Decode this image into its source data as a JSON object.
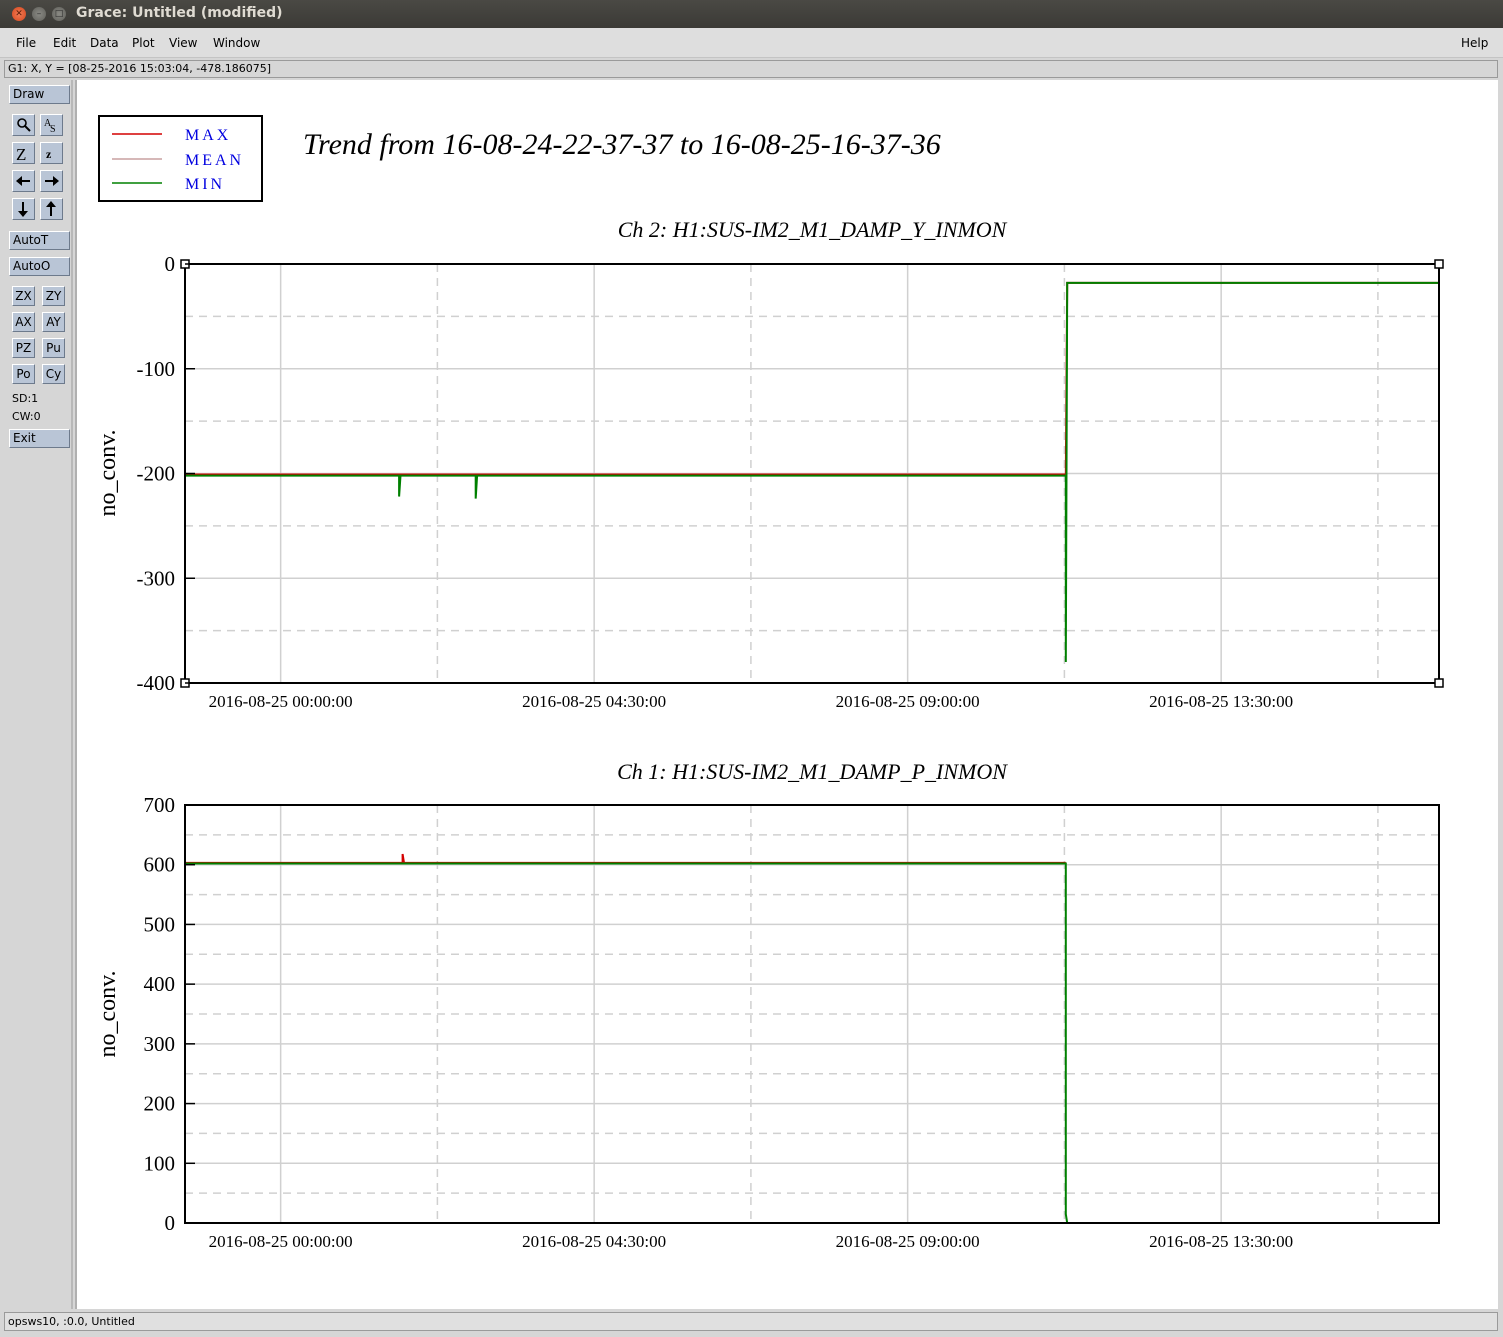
{
  "window": {
    "title": "Grace: Untitled (modified)"
  },
  "menu": {
    "file": "File",
    "edit": "Edit",
    "data": "Data",
    "plot": "Plot",
    "view": "View",
    "window": "Window",
    "help": "Help"
  },
  "coord_readout": "G1: X, Y = [08-25-2016 15:03:04, -478.186075]",
  "toolbar": {
    "draw": "Draw",
    "autot": "AutoT",
    "autoo": "AutoO",
    "zx": "ZX",
    "zy": "ZY",
    "ax": "AX",
    "ay": "AY",
    "pz": "PZ",
    "pu": "Pu",
    "po": "Po",
    "cy": "Cy",
    "sd": "SD:1",
    "cw": "CW:0",
    "exit": "Exit"
  },
  "status": "opsws10, :0.0, Untitled",
  "colors": {
    "max": "#d40000",
    "mean": "#c8a0a0",
    "min": "#008000",
    "legend_text": "#0000e0"
  },
  "chart_data": [
    {
      "type": "line",
      "title": "Trend from 16-08-24-22-37-37 to 16-08-25-16-37-36",
      "legend": [
        "MAX",
        "MEAN",
        "MIN"
      ],
      "legend_placement": "top-left",
      "plots": [
        {
          "title": "Ch 2: H1:SUS-IM2_M1_DAMP_Y_INMON",
          "ylabel": "no_conv.",
          "ylim": [
            -400,
            0
          ],
          "yticks": [
            "0",
            "-100",
            "-200",
            "-300",
            "-400"
          ],
          "xticks": [
            "2016-08-25 00:00:00",
            "2016-08-25 04:30:00",
            "2016-08-25 09:00:00",
            "2016-08-25 13:30:00"
          ],
          "xlim_hours": [
            -1.373,
            16.627
          ],
          "grid": true,
          "series": [
            {
              "name": "MIN",
              "x_hours": [
                -1.373,
                1.7,
                1.7,
                1.72,
                2.8,
                2.8,
                2.82,
                11.27,
                11.27,
                11.29,
                16.627
              ],
              "y": [
                -202,
                -202,
                -222,
                -202,
                -202,
                -224,
                -202,
                -202,
                -380,
                -18,
                -18
              ]
            },
            {
              "name": "MAX",
              "x_hours": [
                -1.373,
                11.27,
                11.29,
                16.627
              ],
              "y": [
                -201,
                -201,
                -18,
                -18
              ]
            }
          ]
        },
        {
          "title": "Ch 1: H1:SUS-IM2_M1_DAMP_P_INMON",
          "ylabel": "no_conv.",
          "ylim": [
            0,
            700
          ],
          "yticks": [
            "700",
            "600",
            "500",
            "400",
            "300",
            "200",
            "100",
            "0"
          ],
          "xticks": [
            "2016-08-25 00:00:00",
            "2016-08-25 04:30:00",
            "2016-08-25 09:00:00",
            "2016-08-25 13:30:00"
          ],
          "xlim_hours": [
            -1.373,
            16.627
          ],
          "grid": true,
          "series": [
            {
              "name": "MIN",
              "x_hours": [
                -1.373,
                11.27,
                11.27,
                11.29,
                16.3
              ],
              "y": [
                602,
                602,
                15,
                0,
                0
              ]
            },
            {
              "name": "MAX",
              "x_hours": [
                -1.373,
                1.75,
                1.75,
                1.77,
                11.27
              ],
              "y": [
                603,
                603,
                618,
                603,
                603
              ]
            }
          ]
        }
      ]
    }
  ]
}
